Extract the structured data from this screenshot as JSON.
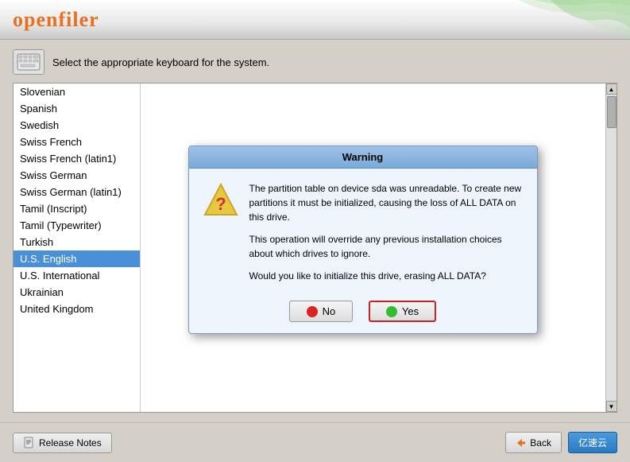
{
  "header": {
    "logo_prefix": "open",
    "logo_accent": "filer"
  },
  "instruction": {
    "text": "Select the appropriate keyboard for the system."
  },
  "languages": [
    {
      "id": "slovenian",
      "label": "Slovenian",
      "selected": false
    },
    {
      "id": "spanish",
      "label": "Spanish",
      "selected": false
    },
    {
      "id": "swedish",
      "label": "Swedish",
      "selected": false
    },
    {
      "id": "swiss-french",
      "label": "Swiss French",
      "selected": false
    },
    {
      "id": "swiss-french-latin1",
      "label": "Swiss French (latin1)",
      "selected": false
    },
    {
      "id": "swiss-german",
      "label": "Swiss German",
      "selected": false
    },
    {
      "id": "swiss-german-latin1",
      "label": "Swiss German (latin1)",
      "selected": false
    },
    {
      "id": "tamil-inscript",
      "label": "Tamil (Inscript)",
      "selected": false
    },
    {
      "id": "tamil-typewriter",
      "label": "Tamil (Typewriter)",
      "selected": false
    },
    {
      "id": "turkish",
      "label": "Turkish",
      "selected": false
    },
    {
      "id": "us-english",
      "label": "U.S. English",
      "selected": true
    },
    {
      "id": "us-international",
      "label": "U.S. International",
      "selected": false
    },
    {
      "id": "ukrainian",
      "label": "Ukrainian",
      "selected": false
    },
    {
      "id": "united-kingdom",
      "label": "United Kingdom",
      "selected": false
    }
  ],
  "dialog": {
    "title": "Warning",
    "message1": "The partition table on device sda was unreadable. To create new partitions it must be initialized, causing the loss of ALL DATA on this drive.",
    "message2": "This operation will override any previous installation choices about which drives to ignore.",
    "message3": "Would you like to initialize this drive, erasing ALL DATA?",
    "no_label": "No",
    "yes_label": "Yes"
  },
  "footer": {
    "release_notes_label": "Release Notes",
    "back_label": "Back",
    "yisu_label": "亿速云"
  }
}
